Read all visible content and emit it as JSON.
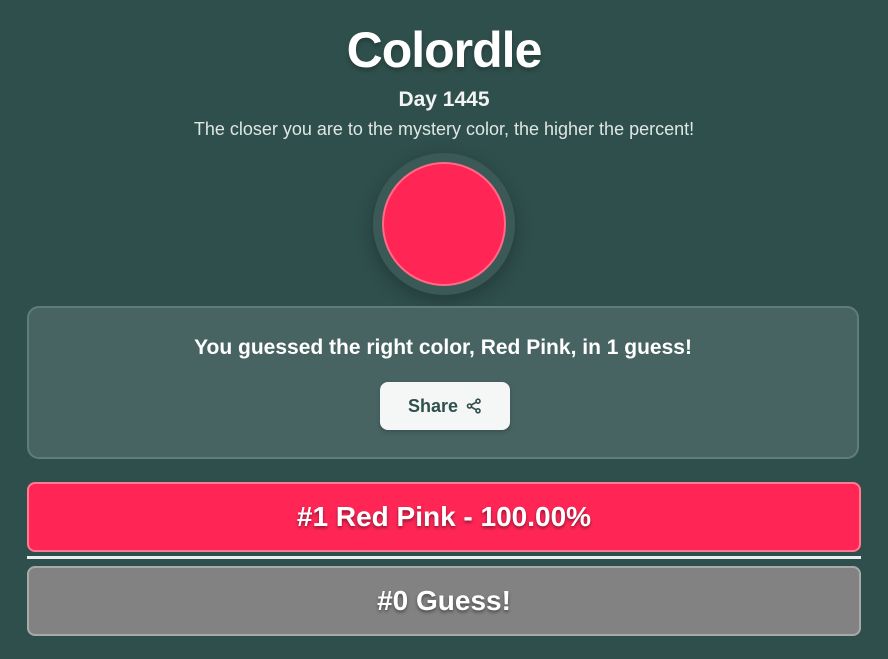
{
  "header": {
    "title": "Colordle",
    "day": "Day 1445",
    "subtitle": "The closer you are to the mystery color, the higher the percent!"
  },
  "mystery_color": {
    "hex": "#ff2656",
    "ring_color": "#ff6a86"
  },
  "result": {
    "message": "You guessed the right color, Red Pink, in 1 guess!",
    "share_label": "Share",
    "share_icon": "share-icon"
  },
  "guesses": [
    {
      "label": "#1 Red Pink - 100.00%",
      "color": "#ff2656",
      "percent": 100.0
    }
  ],
  "input_row": {
    "label": "#0 Guess!",
    "color": "#828282"
  },
  "colors": {
    "background": "#2f4f4c",
    "card": "#476462"
  }
}
